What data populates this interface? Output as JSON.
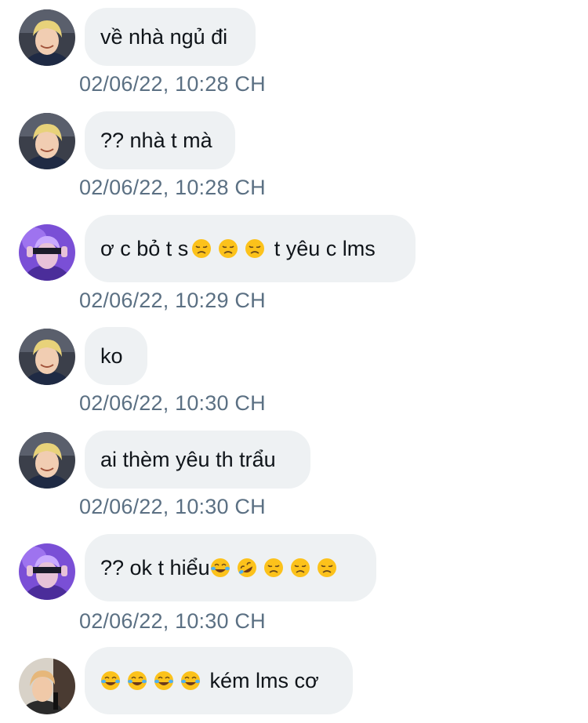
{
  "messages": [
    {
      "avatar": "avatar-blonde",
      "text": "về nhà ngủ đi",
      "timestamp": "02/06/22, 10:28 CH"
    },
    {
      "avatar": "avatar-blonde",
      "text": "?? nhà t mà",
      "timestamp": "02/06/22, 10:28 CH"
    },
    {
      "avatar": "avatar-purple",
      "text_before": "ơ c bỏ t s",
      "emojis_a": [
        "disappointed-face",
        "disappointed-face",
        "disappointed-face"
      ],
      "text_after": " t yêu c lms",
      "timestamp": "02/06/22, 10:29 CH"
    },
    {
      "avatar": "avatar-blonde",
      "text": "ko",
      "timestamp": "02/06/22, 10:30 CH"
    },
    {
      "avatar": "avatar-blonde",
      "text": "ai thèm yêu th trẩu",
      "timestamp": "02/06/22, 10:30 CH"
    },
    {
      "avatar": "avatar-purple",
      "text_before": "?? ok t hiểu",
      "emojis_a": [
        "tears-of-joy",
        "rolling-on-floor-laughing",
        "disappointed-face",
        "disappointed-face",
        "disappointed-face"
      ],
      "timestamp": "02/06/22, 10:30 CH"
    },
    {
      "avatar": "avatar-stage",
      "emojis_a": [
        "tears-of-joy",
        "tears-of-joy",
        "tears-of-joy",
        "tears-of-joy"
      ],
      "text_after": " kém lms cơ"
    }
  ],
  "colors": {
    "bubble": "#eef1f3",
    "timestamp": "#5b7083",
    "text": "#0f1419"
  }
}
